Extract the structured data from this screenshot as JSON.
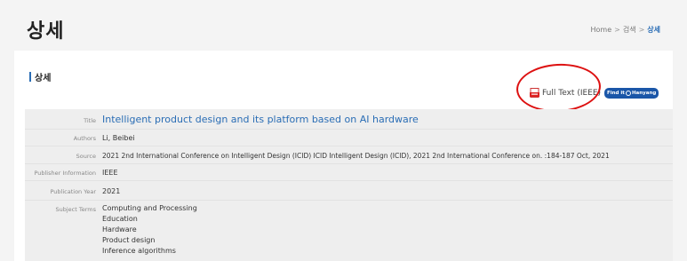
{
  "header": {
    "title": "상세",
    "breadcrumb": {
      "home": "Home",
      "sep1": ">",
      "search": "검색",
      "sep2": ">",
      "current": "상세"
    }
  },
  "section": {
    "title": "상세"
  },
  "actions": {
    "full_text_label": "Full Text (IEEE)",
    "findit_label_1": "Find it",
    "findit_label_2": "Hanyang"
  },
  "record": {
    "title_label": "Title",
    "title_value": "Intelligent product design and its platform based on AI hardware",
    "authors_label": "Authors",
    "authors_value": "Li, Beibei",
    "source_label": "Source",
    "source_value": "2021 2nd International Conference on Intelligent Design (ICID) ICID Intelligent Design (ICID), 2021 2nd International Conference on. :184-187 Oct, 2021",
    "publisher_label": "Publisher Information",
    "publisher_value": "IEEE",
    "year_label": "Publication Year",
    "year_value": "2021",
    "subject_label": "Subject Terms",
    "subject_terms": [
      "Computing and Processing",
      "Education",
      "Hardware",
      "Product design",
      "Inference algorithms"
    ]
  },
  "colors": {
    "accent": "#2a6db5",
    "findit": "#1a56a8",
    "annotation": "#dd1111"
  }
}
